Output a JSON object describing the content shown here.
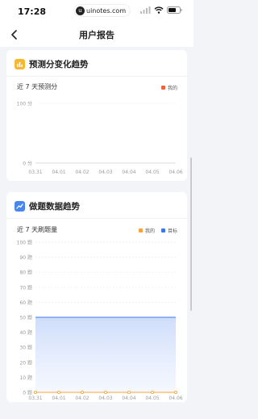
{
  "status_bar": {
    "time": "17:28",
    "watermark": "uinotes.com",
    "watermark_logo": "u"
  },
  "nav": {
    "title": "用户报告",
    "back_icon": "chevron-left-icon"
  },
  "card1": {
    "title": "预测分变化趋势",
    "subtitle": "近 7 天预测分",
    "legend": [
      {
        "label": "我的",
        "color": "#f0643c"
      }
    ],
    "chart_data": {
      "type": "line",
      "title": "近 7 天预测分",
      "categories": [
        "03.31",
        "04.01",
        "04.02",
        "04.03",
        "04.04",
        "04.05",
        "04.06"
      ],
      "y_ticks": [
        "100 分",
        "0 分"
      ],
      "ylim": [
        0,
        100
      ],
      "series": [
        {
          "name": "我的",
          "values": [],
          "color": "#f0643c"
        }
      ],
      "grid": true,
      "legend_position": "top-right"
    }
  },
  "card2": {
    "title": "做题数据趋势",
    "subtitle": "近 7 天刷题量",
    "legend": [
      {
        "label": "我的",
        "color": "#f7a23b"
      },
      {
        "label": "目标",
        "color": "#3b78e7"
      }
    ],
    "chart_data": {
      "type": "line",
      "title": "近 7 天刷题量",
      "categories": [
        "03.31",
        "04.01",
        "04.02",
        "04.03",
        "04.04",
        "04.05",
        "04.06"
      ],
      "y_ticks": [
        "100 题",
        "90 题",
        "80 题",
        "70 题",
        "60 题",
        "50 题",
        "40 题",
        "30 题",
        "20 题",
        "10 题",
        "0 题"
      ],
      "ylim": [
        0,
        100
      ],
      "series": [
        {
          "name": "我的",
          "values": [
            0,
            0,
            0,
            0,
            0,
            0,
            0
          ],
          "color": "#f7a23b"
        },
        {
          "name": "目标",
          "values": [
            50,
            50,
            50,
            50,
            50,
            50,
            50
          ],
          "color": "#3b78e7"
        }
      ],
      "grid": true,
      "legend_position": "top-right"
    }
  },
  "colors": {
    "accent_yellow": "#f7b731",
    "accent_blue": "#4a86f0"
  }
}
